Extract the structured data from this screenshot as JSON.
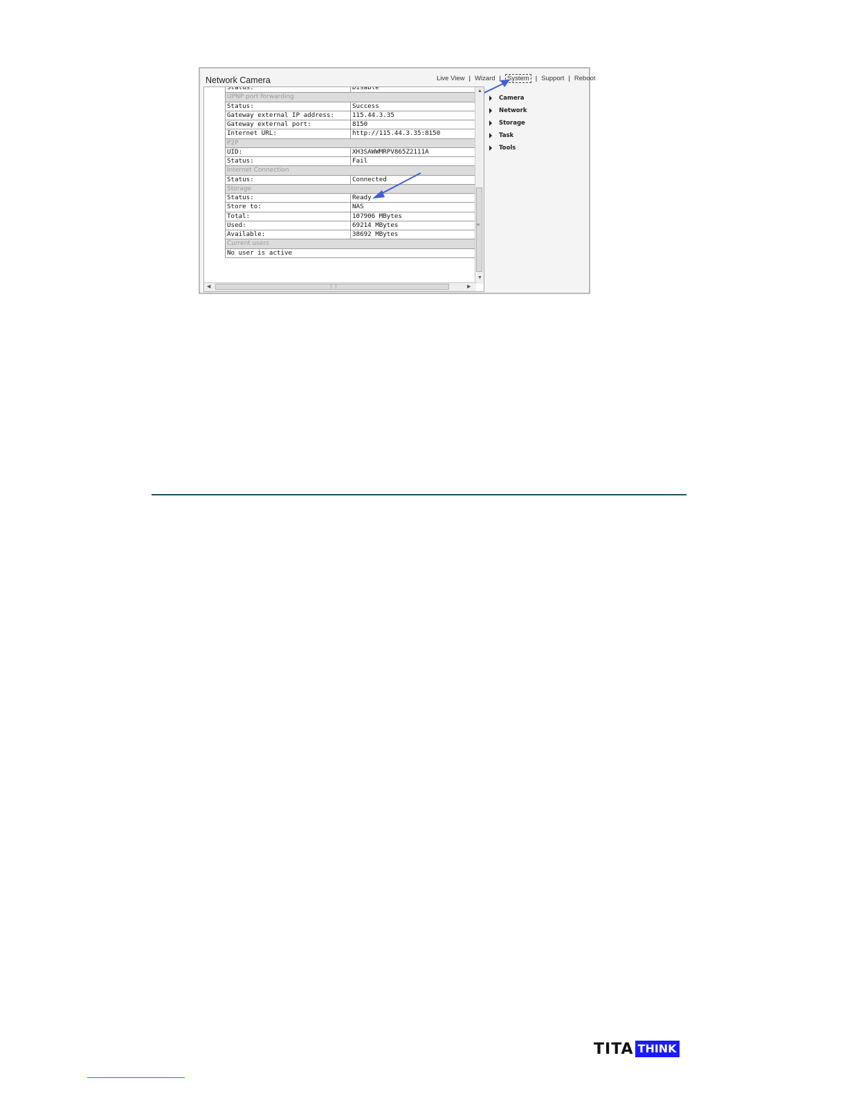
{
  "window": {
    "title": "Network Camera",
    "nav": [
      "Live View",
      "Wizard",
      "System",
      "Support",
      "Reboot"
    ],
    "nav_active": "System"
  },
  "status_table": {
    "clipped_top_row": {
      "key": "Status:",
      "value": "Disable"
    },
    "sections": [
      {
        "header": "UPNP port forwarding",
        "rows": [
          {
            "key": "Status:",
            "value": "Success"
          },
          {
            "key": "Gateway external IP address:",
            "value": "115.44.3.35"
          },
          {
            "key": "Gateway external port:",
            "value": "8150"
          },
          {
            "key": "Internet URL:",
            "value": "http://115.44.3.35:8150"
          }
        ]
      },
      {
        "header": "P2P",
        "rows": [
          {
            "key": "UID:",
            "value": "XH3SAWWMRPV865Z2111A"
          },
          {
            "key": "Status:",
            "value": "Fail"
          }
        ]
      },
      {
        "header": "Internet Connection",
        "rows": [
          {
            "key": "Status:",
            "value": "Connected"
          }
        ]
      },
      {
        "header": "Storage",
        "rows": [
          {
            "key": "Status:",
            "value": "Ready"
          },
          {
            "key": "Store to:",
            "value": "NAS"
          },
          {
            "key": "Total:",
            "value": "107906 MBytes"
          },
          {
            "key": "Used:",
            "value": "69214 MBytes"
          },
          {
            "key": "Available:",
            "value": "38692 MBytes"
          }
        ]
      },
      {
        "header": "Current users",
        "rows": [
          {
            "key": "No user is active",
            "value": ""
          }
        ]
      }
    ]
  },
  "side_menu": [
    "Camera",
    "Network",
    "Storage",
    "Task",
    "Tools"
  ],
  "annotation_color": "#3d5fd6",
  "footer": {
    "logo_left": "TITA",
    "logo_right": "THINK",
    "logo_color": "#1a1aff"
  },
  "rule_color": "#1f4e5f"
}
